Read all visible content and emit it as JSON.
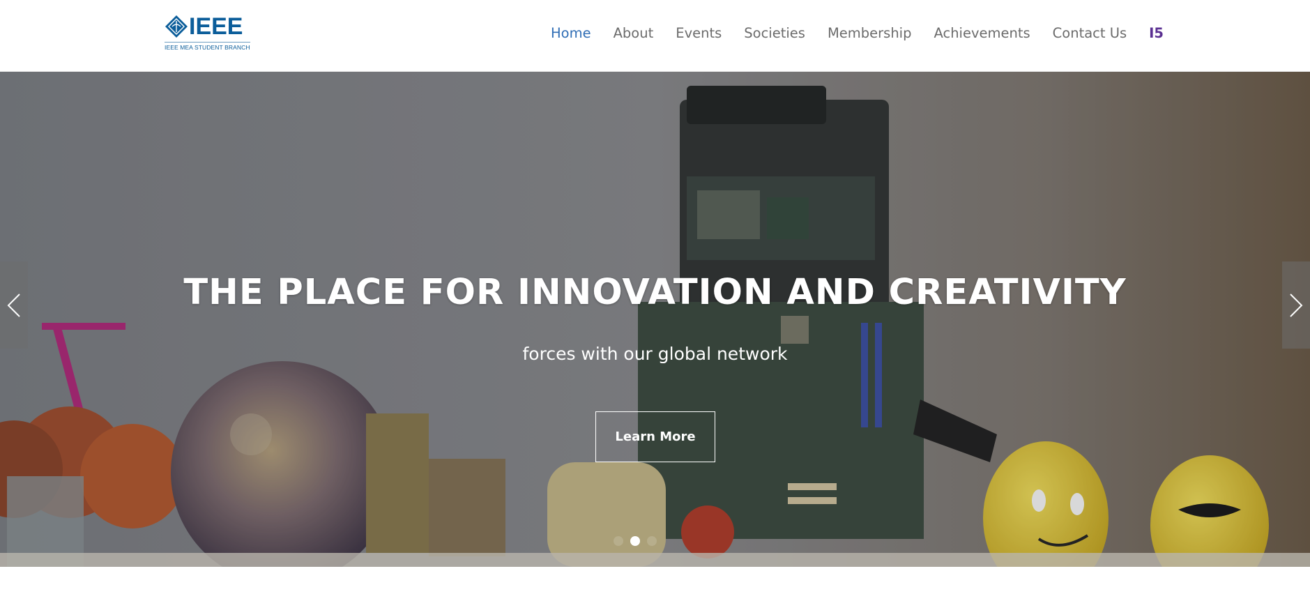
{
  "brand": {
    "logo_text": "IEEE",
    "logo_subtitle": "IEEE MEA STUDENT BRANCH",
    "logo_color": "#0b5d9a"
  },
  "nav": {
    "items": [
      {
        "label": "Home",
        "active": true
      },
      {
        "label": "About"
      },
      {
        "label": "Events"
      },
      {
        "label": "Societies"
      },
      {
        "label": "Membership"
      },
      {
        "label": "Achievements"
      },
      {
        "label": "Contact Us"
      },
      {
        "label": "I5",
        "special": true
      }
    ],
    "active_color": "#2f6db5",
    "special_color": "#5a2f91"
  },
  "hero": {
    "title": "THE PLACE FOR INNOVATION AND CREATIVITY",
    "subtitle": "forces with our global network",
    "button_label": "Learn More",
    "prev_icon": "chevron-left-icon",
    "next_icon": "chevron-right-icon",
    "slides_count": 3,
    "active_slide": 2
  }
}
